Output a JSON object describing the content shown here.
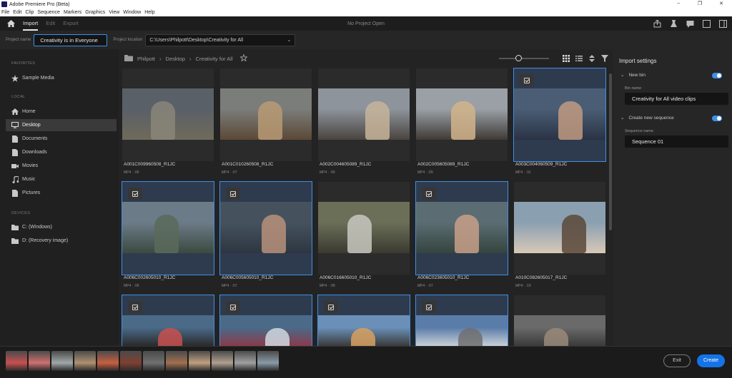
{
  "window": {
    "title": "Adobe Premiere Pro (Beta)",
    "controls": [
      "−",
      "❐",
      "✕"
    ]
  },
  "menu": [
    "File",
    "Edit",
    "Clip",
    "Sequence",
    "Markers",
    "Graphics",
    "View",
    "Window",
    "Help"
  ],
  "appbar": {
    "tabs": [
      "Import",
      "Edit",
      "Export"
    ],
    "active_tab": "Import",
    "status": "No Project Open"
  },
  "project": {
    "name_label": "Project name",
    "name_value": "Creativity is in Everyone",
    "location_label": "Project location",
    "location_value": "C:\\Users\\Philpott\\Desktop\\Creativity for All"
  },
  "sidebar": {
    "favorites_header": "FAVORITES",
    "favorites": [
      {
        "label": "Sample Media",
        "icon": "star-icon"
      }
    ],
    "local_header": "LOCAL",
    "local": [
      {
        "label": "Home",
        "icon": "home-icon"
      },
      {
        "label": "Desktop",
        "icon": "monitor-icon",
        "selected": true
      },
      {
        "label": "Documents",
        "icon": "document-icon"
      },
      {
        "label": "Downloads",
        "icon": "download-icon"
      },
      {
        "label": "Movies",
        "icon": "film-icon"
      },
      {
        "label": "Music",
        "icon": "music-note-icon"
      },
      {
        "label": "Pictures",
        "icon": "picture-icon"
      }
    ],
    "devices_header": "DEVICES",
    "devices": [
      {
        "label": "C: (Windows)",
        "icon": "folder-icon"
      },
      {
        "label": "D: (Recovery image)",
        "icon": "folder-icon"
      }
    ]
  },
  "breadcrumb": [
    "Philpott",
    "Desktop",
    "Creativity for All"
  ],
  "thumbnail_size": 0.35,
  "clips": [
    {
      "name": "A001C009960508_R1JC",
      "meta": "MP4 · :06",
      "selected": false,
      "colors": [
        "#5a6068",
        "#8a8679",
        "#6f6a5a"
      ]
    },
    {
      "name": "A001C010260508_R1JC",
      "meta": "MP4 · :07",
      "selected": false,
      "colors": [
        "#7b7d7a",
        "#b89a74",
        "#5b4836"
      ]
    },
    {
      "name": "A002C004605089_R1JC",
      "meta": "MP4 · :06",
      "selected": false,
      "colors": [
        "#8d949b",
        "#c7b49a",
        "#4a4440"
      ]
    },
    {
      "name": "A002C005605089_R1JC",
      "meta": "MP4 · :09",
      "selected": false,
      "colors": [
        "#9aa0a6",
        "#d2b48a",
        "#3f3a36"
      ]
    },
    {
      "name": "A003C004060509_R1JC",
      "meta": "MP4 · :31",
      "selected": true,
      "colors": [
        "#4a5d75",
        "#c09a80",
        "#2a3344"
      ]
    },
    {
      "name": "A006C002605010_R1JC",
      "meta": "MP4 · :06",
      "selected": true,
      "colors": [
        "#6c7b88",
        "#5a6a5a",
        "#3b4a3f"
      ]
    },
    {
      "name": "A006C005605010_R1JC",
      "meta": "MP4 · :07",
      "selected": true,
      "colors": [
        "#45525e",
        "#b8907a",
        "#2d3640"
      ]
    },
    {
      "name": "A006C016605010_R1JC",
      "meta": "MP4 · :08",
      "selected": false,
      "colors": [
        "#6b6f58",
        "#c8c8c0",
        "#3a3a30"
      ]
    },
    {
      "name": "A006C023605010_R1JC",
      "meta": "MP4 · :07",
      "selected": true,
      "colors": [
        "#5b6d72",
        "#c8a088",
        "#34443f"
      ]
    },
    {
      "name": "A010C082605017_R1JC",
      "meta": "MP4 · :10",
      "selected": false,
      "colors": [
        "#8aa0b0",
        "#5a4838",
        "#d8c8b8"
      ]
    },
    {
      "name": "",
      "meta": "",
      "selected": true,
      "colors": [
        "#4a6a88",
        "#c85050",
        "#2a2a2a"
      ]
    },
    {
      "name": "",
      "meta": "",
      "selected": true,
      "colors": [
        "#4a6a88",
        "#d0d8e0",
        "#8a3a4a"
      ]
    },
    {
      "name": "",
      "meta": "",
      "selected": true,
      "colors": [
        "#6a90b8",
        "#d8a060",
        "#3a3a3a"
      ]
    },
    {
      "name": "",
      "meta": "",
      "selected": true,
      "colors": [
        "#5a7ca8",
        "#707070",
        "#c8d0d8"
      ]
    },
    {
      "name": "",
      "meta": "",
      "selected": false,
      "colors": [
        "#6a6a6a",
        "#9a8a7a",
        "#3a3a3a"
      ]
    }
  ],
  "import_settings": {
    "title": "Import settings",
    "new_bin_label": "New bin",
    "new_bin_on": true,
    "bin_name_label": "Bin name",
    "bin_name_value": "Creativity for All video clips",
    "new_seq_label": "Create new sequence",
    "new_seq_on": true,
    "seq_name_label": "Sequence name",
    "seq_name_value": "Sequence 01"
  },
  "strip_colors": [
    "#c85050",
    "#d07070",
    "#a0a8a8",
    "#b09070",
    "#c86040",
    "#804030",
    "#707070",
    "#a07050",
    "#c0a080",
    "#b0a090",
    "#a0a0a0",
    "#8a9aa8"
  ],
  "buttons": {
    "exit": "Exit",
    "create": "Create"
  },
  "accent": "#1473e6"
}
